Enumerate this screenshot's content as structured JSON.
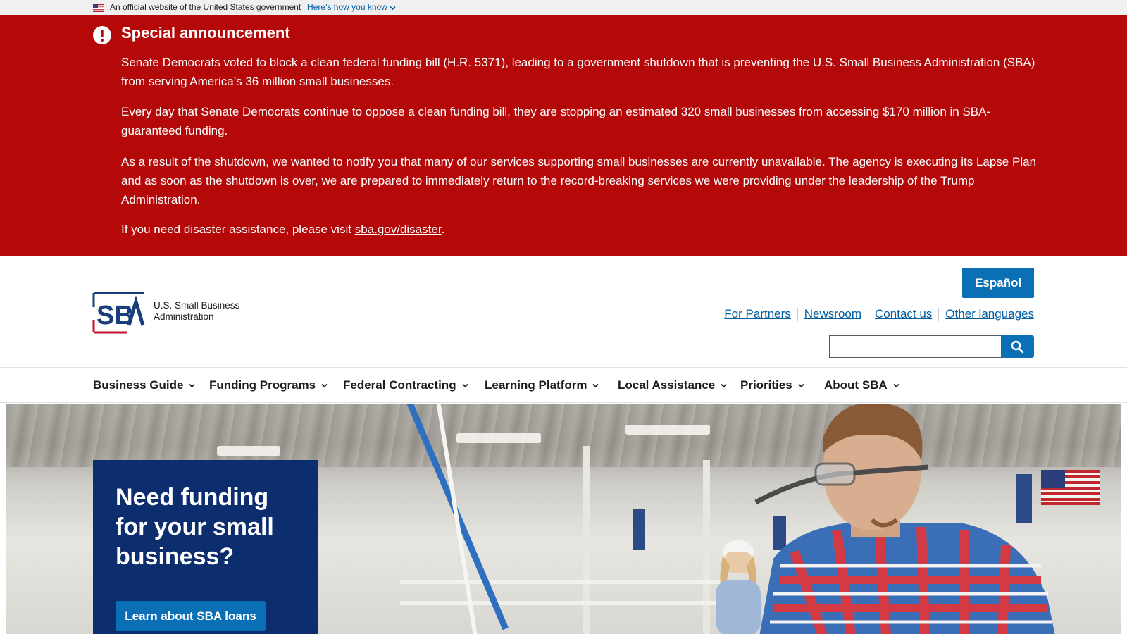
{
  "gov_banner": {
    "official_text": "An official website of the United States government",
    "how_know_link": "Here’s how you know"
  },
  "announcement": {
    "title": "Special announcement",
    "p1": "Senate Democrats voted to block a clean federal funding bill (H.R. 5371), leading to a government shutdown that is preventing the U.S. Small Business Administration (SBA) from serving America’s 36 million small businesses.",
    "p2": "Every day that Senate Democrats continue to oppose a clean funding bill, they are stopping an estimated 320 small businesses from accessing $170 million in SBA-guaranteed funding.",
    "p3": "As a result of the shutdown, we wanted to notify you that many of our services supporting small businesses are currently unavailable. The agency is executing its Lapse Plan and as soon as the shutdown is over, we are prepared to immediately return to the record-breaking services we were providing under the leadership of the Trump Administration.",
    "p4_prefix": "If you need disaster assistance, please visit ",
    "p4_link": "sba.gov/disaster",
    "p4_suffix": "."
  },
  "header": {
    "logo_line1": "U.S. Small Business",
    "logo_line2": "Administration",
    "espanol_label": "Español",
    "links": [
      "For Partners",
      "Newsroom",
      "Contact us",
      "Other languages"
    ],
    "search_value": ""
  },
  "nav": {
    "items": [
      "Business Guide",
      "Funding Programs",
      "Federal Contracting",
      "Learning Platform",
      "Local Assistance",
      "Priorities",
      "About SBA"
    ]
  },
  "hero": {
    "headline": "Need funding for your small business?",
    "button_label": "Learn about SBA loans"
  },
  "colors": {
    "announcement_red": "#b50909",
    "primary_blue": "#0b6fb5",
    "navy": "#0d2e6e",
    "link_blue": "#005ea2"
  },
  "icons": {
    "flag": "us-flag-icon",
    "chevron": "chevron-down-icon",
    "alert": "exclamation-circle-icon",
    "search": "search-icon"
  }
}
